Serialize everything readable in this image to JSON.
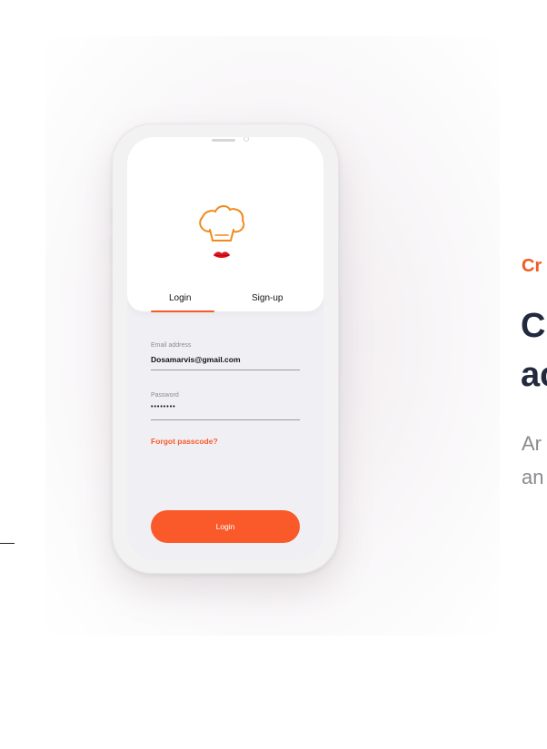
{
  "side_text": {
    "kicker": "Cr",
    "heading_line1": "C",
    "heading_line2": "ac",
    "body_line1": "Ar",
    "body_line2": "an"
  },
  "app": {
    "tabs": {
      "login": "Login",
      "signup": "Sign-up",
      "active": "Login"
    },
    "email": {
      "label": "Email address",
      "value": "Dosamarvis@gmail.com"
    },
    "password": {
      "label": "Password",
      "value": "••••••••"
    },
    "forgot_link": "Forgot passcode?",
    "login_button": "Login",
    "logo_icon": "chef-hat-lips-icon"
  },
  "colors": {
    "accent": "#fa5a2a",
    "heading": "#232a3e",
    "muted_text": "#8a8a8f",
    "screen_bg": "#f0f0f4"
  }
}
